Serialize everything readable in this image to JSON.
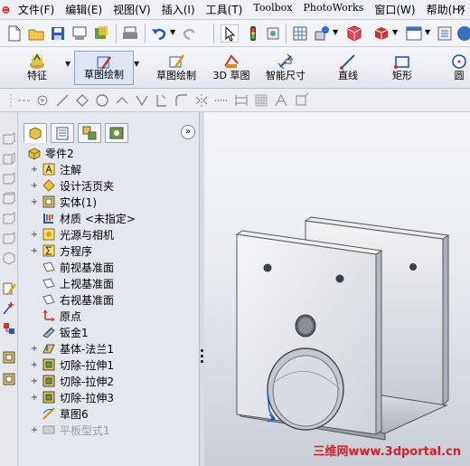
{
  "menubar": {
    "items": [
      {
        "label": "文件(F)",
        "latin": false
      },
      {
        "label": "编辑(E)",
        "latin": false
      },
      {
        "label": "视图(V)",
        "latin": false
      },
      {
        "label": "插入(I)",
        "latin": false
      },
      {
        "label": "工具(T)",
        "latin": false
      },
      {
        "label": "Toolbox",
        "latin": true
      },
      {
        "label": "PhotoWorks",
        "latin": true
      },
      {
        "label": "窗口(W)",
        "latin": false
      },
      {
        "label": "帮助(H)",
        "latin": false
      }
    ],
    "close_glyph": "×"
  },
  "command_manager": {
    "features_label": "特征",
    "sketch_label": "草图绘制",
    "sketch_draw_label": "草图绘制",
    "sketch3d_label": "3D 草图",
    "smart_dim_label": "智能尺寸",
    "line_label": "直线",
    "rect_label": "矩形",
    "circle_label": "圆"
  },
  "feature_manager": {
    "expand_glyph": "»",
    "tree": [
      {
        "label": "零件2",
        "icon": "part-icon",
        "expand": "",
        "root": true,
        "dim": false
      },
      {
        "label": "注解",
        "icon": "annotation-icon",
        "expand": "+",
        "root": false,
        "dim": false
      },
      {
        "label": "设计活页夹",
        "icon": "design-binder-icon",
        "expand": "+",
        "root": false,
        "dim": false
      },
      {
        "label": "实体(1)",
        "icon": "solid-bodies-icon",
        "expand": "+",
        "root": false,
        "dim": false
      },
      {
        "label": "材质 <未指定>",
        "icon": "material-icon",
        "expand": "",
        "root": false,
        "dim": false
      },
      {
        "label": "光源与相机",
        "icon": "lights-cameras-icon",
        "expand": "+",
        "root": false,
        "dim": false
      },
      {
        "label": "方程序",
        "icon": "equations-icon",
        "expand": "+",
        "root": false,
        "dim": false
      },
      {
        "label": "前视基准面",
        "icon": "plane-icon",
        "expand": "",
        "root": false,
        "dim": false
      },
      {
        "label": "上视基准面",
        "icon": "plane-icon",
        "expand": "",
        "root": false,
        "dim": false
      },
      {
        "label": "右视基准面",
        "icon": "plane-icon",
        "expand": "",
        "root": false,
        "dim": false
      },
      {
        "label": "原点",
        "icon": "origin-icon",
        "expand": "",
        "root": false,
        "dim": false
      },
      {
        "label": "钣金1",
        "icon": "sheet-metal-icon",
        "expand": "",
        "root": false,
        "dim": false
      },
      {
        "label": "基体-法兰1",
        "icon": "base-flange-icon",
        "expand": "+",
        "root": false,
        "dim": false
      },
      {
        "label": "切除-拉伸1",
        "icon": "cut-extrude-icon",
        "expand": "+",
        "root": false,
        "dim": false
      },
      {
        "label": "切除-拉伸2",
        "icon": "cut-extrude-icon",
        "expand": "+",
        "root": false,
        "dim": false
      },
      {
        "label": "切除-拉伸3",
        "icon": "cut-extrude-icon",
        "expand": "+",
        "root": false,
        "dim": false
      },
      {
        "label": "草图6",
        "icon": "sketch-icon",
        "expand": "",
        "root": false,
        "dim": false
      },
      {
        "label": "平板型式1",
        "icon": "flat-pattern-icon",
        "expand": "+",
        "root": false,
        "dim": true
      }
    ]
  },
  "watermark": "三维网www.3dportal.cn",
  "colors": {
    "accent": "#1f5fbf",
    "watermark": "#d0232a"
  }
}
